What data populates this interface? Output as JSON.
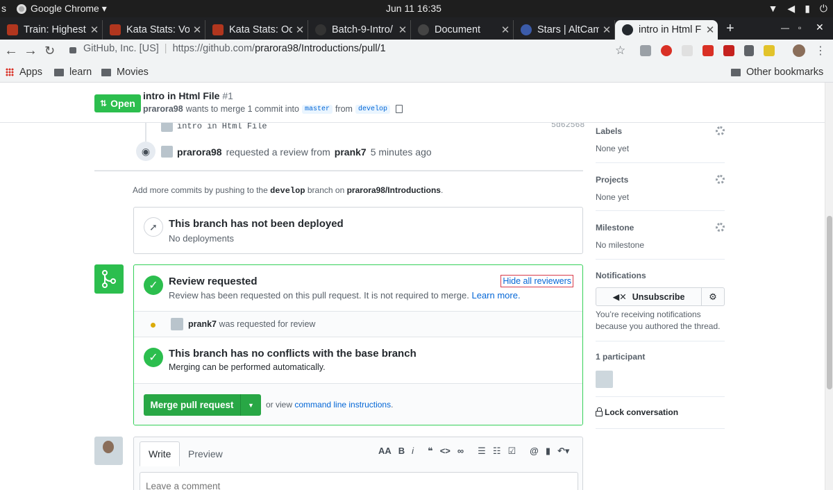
{
  "os": {
    "left_glyph": "s",
    "app_menu": "Google Chrome ▾",
    "clock": "Jun 11  16:35"
  },
  "tabs": [
    {
      "title": "Train: Highest",
      "icon_color": "#b1361e"
    },
    {
      "title": "Kata Stats: Vo",
      "icon_color": "#b1361e"
    },
    {
      "title": "Kata Stats: Od",
      "icon_color": "#b1361e"
    },
    {
      "title": "Batch-9-Intro/",
      "icon_color": "#333333"
    },
    {
      "title": "Document",
      "icon_color": "#444444"
    },
    {
      "title": "Stars | AltCam",
      "icon_color": "#3b5ba9"
    },
    {
      "title": "intro in Html F",
      "icon_color": "#24292e",
      "active": true
    }
  ],
  "toolbar": {
    "site_identity": "GitHub, Inc. [US]",
    "url_prefix": "https://github.com/",
    "url_path": "prarora98/Introductions/pull/1"
  },
  "bookmarks": {
    "apps": "Apps",
    "items": [
      "learn",
      "Movies"
    ],
    "other": "Other bookmarks"
  },
  "pr": {
    "state": "Open",
    "title": "intro in Html File",
    "number": "#1",
    "author": "prarora98",
    "merge_text_1": "wants to merge 1 commit into",
    "base_branch": "master",
    "from_text": "from",
    "head_branch": "develop"
  },
  "timeline": {
    "commit_message": "intro in Html File",
    "commit_sha": "5d62568",
    "review_actor": "prarora98",
    "review_text": "requested a review from",
    "reviewer": "prank7",
    "review_time": "5 minutes ago"
  },
  "add_commits": {
    "prefix": "Add more commits by pushing to the",
    "branch": "develop",
    "middle": "branch on",
    "repo": "prarora98/Introductions",
    "suffix": "."
  },
  "deploy": {
    "title": "This branch has not been deployed",
    "subtitle": "No deployments"
  },
  "merge_box": {
    "review_title": "Review requested",
    "review_sub": "Review has been requested on this pull request. It is not required to merge.",
    "learn_more": "Learn more.",
    "hide_reviewers": "Hide all reviewers",
    "reviewer_name": "prank7",
    "reviewer_status": "was requested for review",
    "conflicts_title": "This branch has no conflicts with the base branch",
    "conflicts_sub": "Merging can be performed automatically.",
    "merge_button": "Merge pull request",
    "or_view": "or view",
    "cli_link": "command line instructions",
    "cli_suffix": "."
  },
  "comment": {
    "tab_write": "Write",
    "tab_preview": "Preview",
    "placeholder": "Leave a comment"
  },
  "sidebar": {
    "labels_h": "Labels",
    "labels_v": "None yet",
    "projects_h": "Projects",
    "projects_v": "None yet",
    "milestone_h": "Milestone",
    "milestone_v": "No milestone",
    "notifications_h": "Notifications",
    "unsubscribe": "Unsubscribe",
    "notif_reason_1": "You’re receiving notifications",
    "notif_reason_2": "because you authored the thread.",
    "participants": "1 participant",
    "lock": "Lock conversation"
  },
  "colors": {
    "open_green": "#2cbe4e",
    "merge_green": "#28a745",
    "link_blue": "#0366d6"
  }
}
